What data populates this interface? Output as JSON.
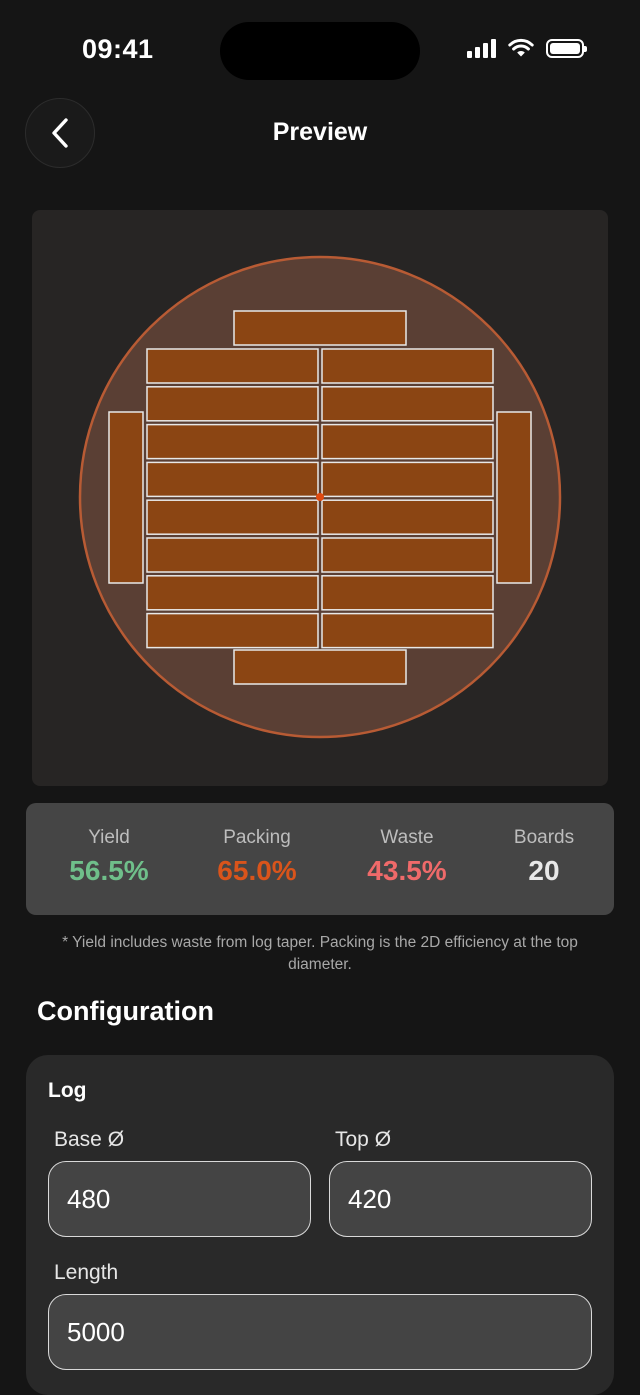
{
  "status_bar": {
    "time": "09:41"
  },
  "nav": {
    "title": "Preview"
  },
  "colors": {
    "background": "#151515",
    "log_fill": "#5a3f34",
    "log_stroke": "#b85b34",
    "board_fill": "#8b4513",
    "board_stroke": "#e8e8e8",
    "center_dot": "#e04a10",
    "yield": "#6fbf8a",
    "packing": "#d9541b",
    "waste": "#ef6a6a",
    "boards": "#e8e8e8"
  },
  "cut_diagram": {
    "log_diameter": 480,
    "top_diameter": 420,
    "board_count": 20
  },
  "stats": [
    {
      "label": "Yield",
      "value": "56.5%",
      "color": "#6fbf8a"
    },
    {
      "label": "Packing",
      "value": "65.0%",
      "color": "#d9541b"
    },
    {
      "label": "Waste",
      "value": "43.5%",
      "color": "#ef6a6a"
    },
    {
      "label": "Boards",
      "value": "20",
      "color": "#e8e8e8"
    }
  ],
  "footnote": "* Yield includes waste from log taper. Packing is the 2D efficiency at the top diameter.",
  "configuration": {
    "title": "Configuration",
    "log": {
      "title": "Log",
      "base_label": "Base Ø",
      "base_value": "480",
      "top_label": "Top Ø",
      "top_value": "420",
      "length_label": "Length",
      "length_value": "5000"
    }
  }
}
